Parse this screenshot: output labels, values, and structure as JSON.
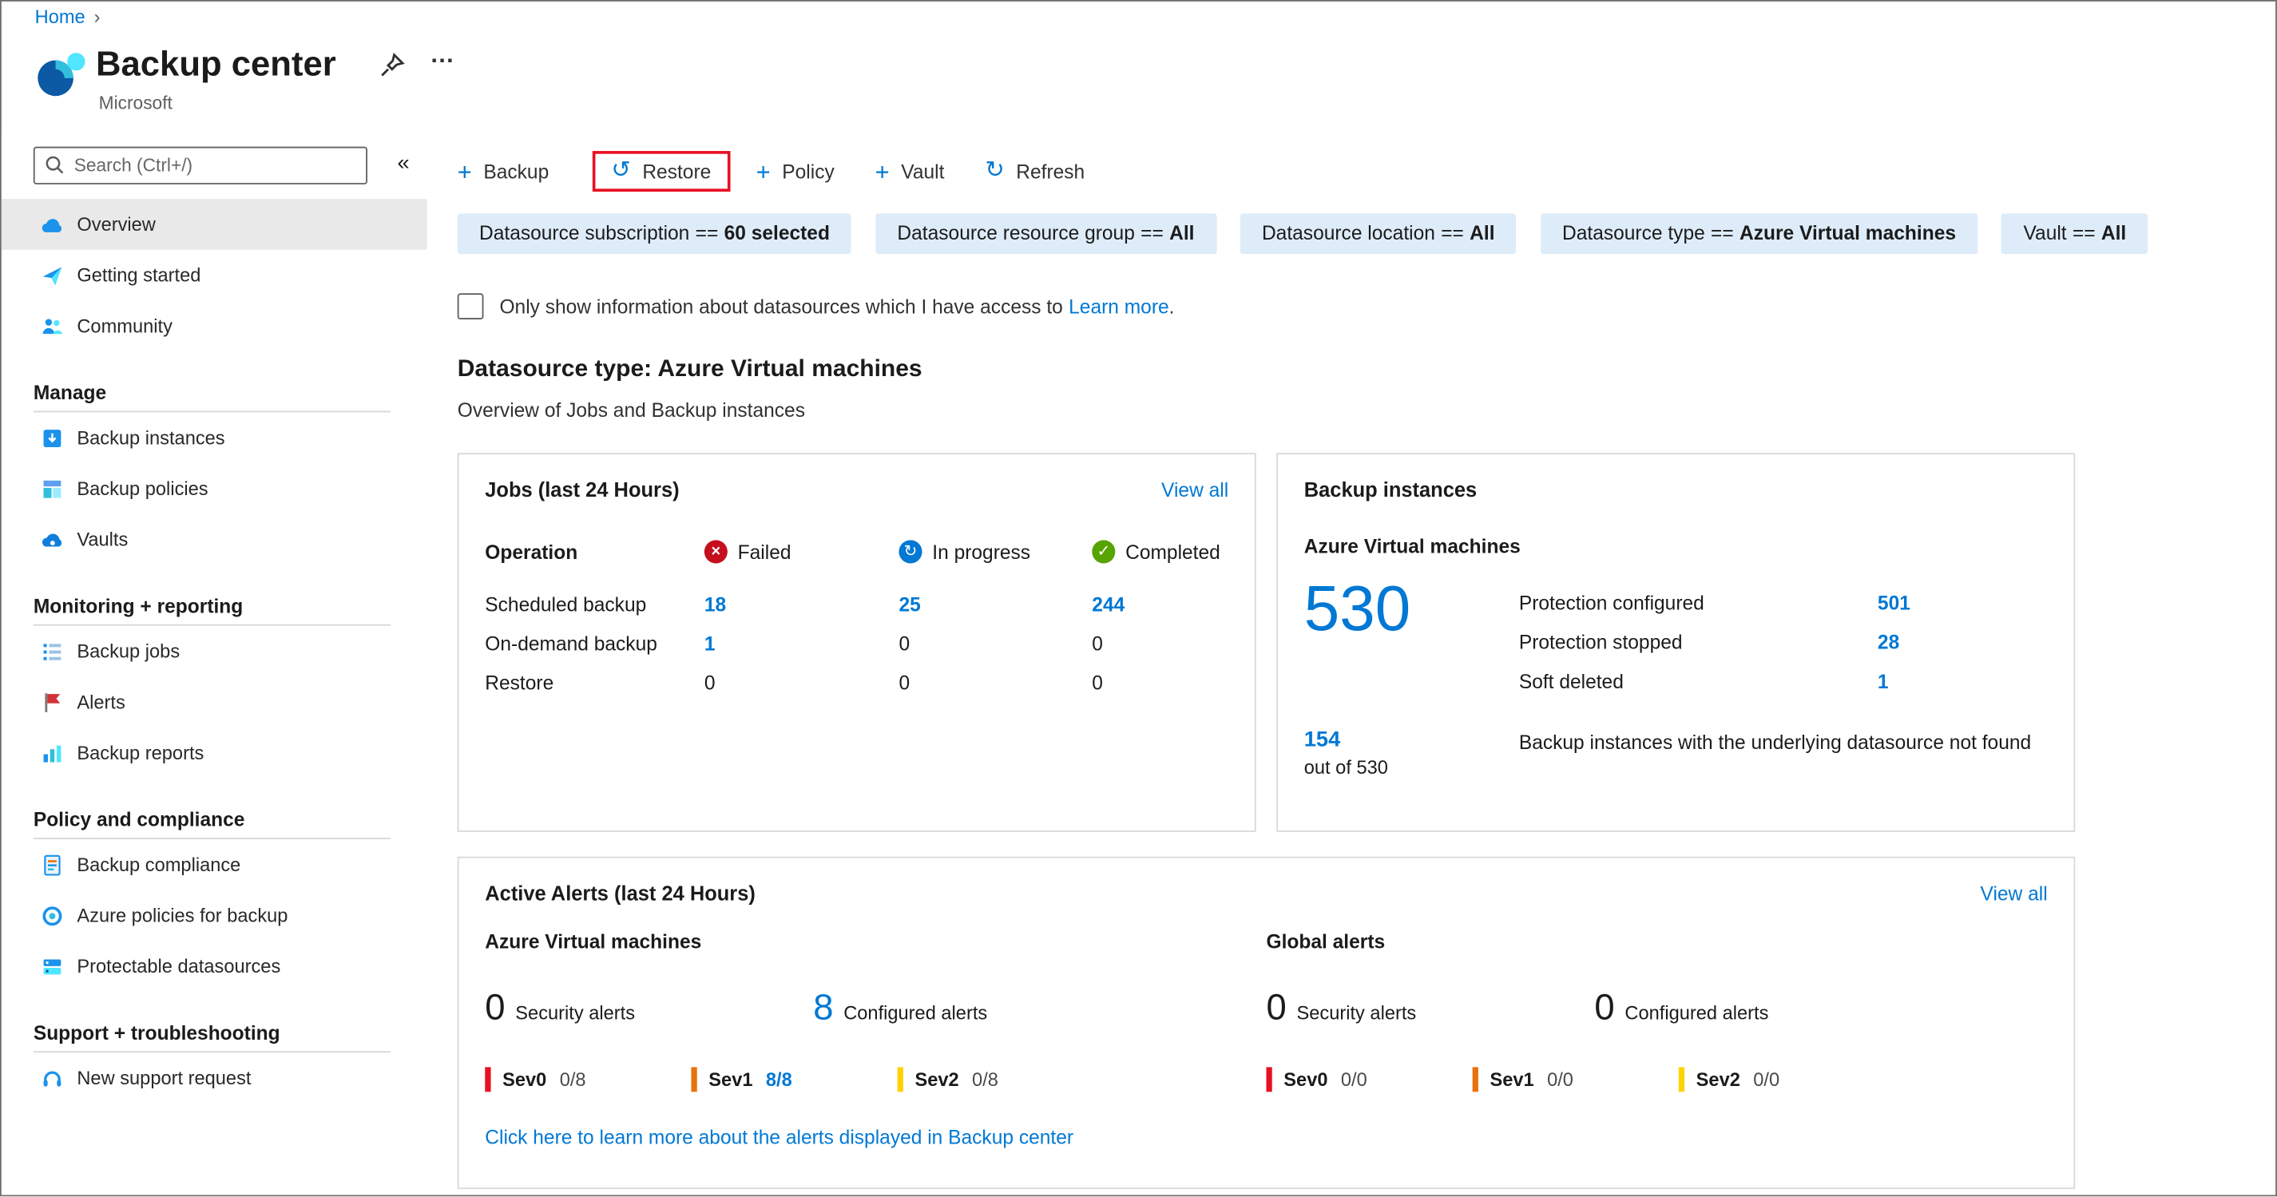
{
  "breadcrumb": {
    "home": "Home",
    "separator": "›"
  },
  "header": {
    "title": "Backup center",
    "subtitle": "Microsoft",
    "ellipsis": "…"
  },
  "sidebar": {
    "search_placeholder": "Search (Ctrl+/)",
    "collapse": "«",
    "top_items": [
      {
        "label": "Overview"
      },
      {
        "label": "Getting started"
      },
      {
        "label": "Community"
      }
    ],
    "sections": [
      {
        "title": "Manage",
        "items": [
          {
            "label": "Backup instances"
          },
          {
            "label": "Backup policies"
          },
          {
            "label": "Vaults"
          }
        ]
      },
      {
        "title": "Monitoring + reporting",
        "items": [
          {
            "label": "Backup jobs"
          },
          {
            "label": "Alerts"
          },
          {
            "label": "Backup reports"
          }
        ]
      },
      {
        "title": "Policy and compliance",
        "items": [
          {
            "label": "Backup compliance"
          },
          {
            "label": "Azure policies for backup"
          },
          {
            "label": "Protectable datasources"
          }
        ]
      },
      {
        "title": "Support + troubleshooting",
        "items": [
          {
            "label": "New support request"
          }
        ]
      }
    ]
  },
  "toolbar": {
    "backup": "Backup",
    "restore": "Restore",
    "policy": "Policy",
    "vault": "Vault",
    "refresh": "Refresh",
    "plus": "+",
    "restore_glyph": "↺",
    "refresh_glyph": "↻"
  },
  "filters": [
    {
      "name": "Datasource subscription",
      "op": "==",
      "value": "60 selected"
    },
    {
      "name": "Datasource resource group",
      "op": "==",
      "value": "All"
    },
    {
      "name": "Datasource location",
      "op": "==",
      "value": "All"
    },
    {
      "name": "Datasource type",
      "op": "==",
      "value": "Azure Virtual machines"
    },
    {
      "name": "Vault",
      "op": "==",
      "value": "All"
    }
  ],
  "access_filter": {
    "text": "Only show information about datasources which I have access to",
    "link": "Learn more",
    "period": "."
  },
  "datasource_section": {
    "title": "Datasource type: Azure Virtual machines",
    "subtitle": "Overview of Jobs and Backup instances"
  },
  "jobs_card": {
    "title": "Jobs (last 24 Hours)",
    "view_all": "View all",
    "columns": {
      "operation": "Operation",
      "failed": "Failed",
      "in_progress": "In progress",
      "completed": "Completed"
    },
    "glyphs": {
      "failed": "×",
      "in_progress": "↻",
      "completed": "✓"
    },
    "rows": [
      {
        "operation": "Scheduled backup",
        "failed": "18",
        "in_progress": "25",
        "completed": "244"
      },
      {
        "operation": "On-demand backup",
        "failed": "1",
        "in_progress": "0",
        "completed": "0"
      },
      {
        "operation": "Restore",
        "failed": "0",
        "in_progress": "0",
        "completed": "0"
      }
    ]
  },
  "instances_card": {
    "title": "Backup instances",
    "group": "Azure Virtual machines",
    "total": "530",
    "stats": [
      {
        "label": "Protection configured",
        "value": "501"
      },
      {
        "label": "Protection stopped",
        "value": "28"
      },
      {
        "label": "Soft deleted",
        "value": "1"
      }
    ],
    "not_found": {
      "count": "154",
      "fraction": "out of 530",
      "text": "Backup instances with the underlying datasource not found"
    }
  },
  "alerts_card": {
    "title": "Active Alerts (last 24 Hours)",
    "view_all": "View all",
    "groups": [
      {
        "title": "Azure Virtual machines",
        "security_count": "0",
        "security_label": "Security alerts",
        "configured_count": "8",
        "configured_label": "Configured alerts",
        "severities": [
          {
            "name": "Sev0",
            "value": "0/8"
          },
          {
            "name": "Sev1",
            "value": "8/8"
          },
          {
            "name": "Sev2",
            "value": "0/8"
          }
        ]
      },
      {
        "title": "Global alerts",
        "security_count": "0",
        "security_label": "Security alerts",
        "configured_count": "0",
        "configured_label": "Configured alerts",
        "severities": [
          {
            "name": "Sev0",
            "value": "0/0"
          },
          {
            "name": "Sev1",
            "value": "0/0"
          },
          {
            "name": "Sev2",
            "value": "0/0"
          }
        ]
      }
    ],
    "footer_link": "Click here to learn more about the alerts displayed in Backup center"
  },
  "colors": {
    "accent": "#0078d4",
    "sev0": "#e81123",
    "sev1": "#e8720c",
    "sev2": "#ffd302",
    "restore_highlight": "#e81123",
    "failed": "#c50f1f",
    "in_progress": "#0078d4",
    "completed": "#57a300"
  }
}
